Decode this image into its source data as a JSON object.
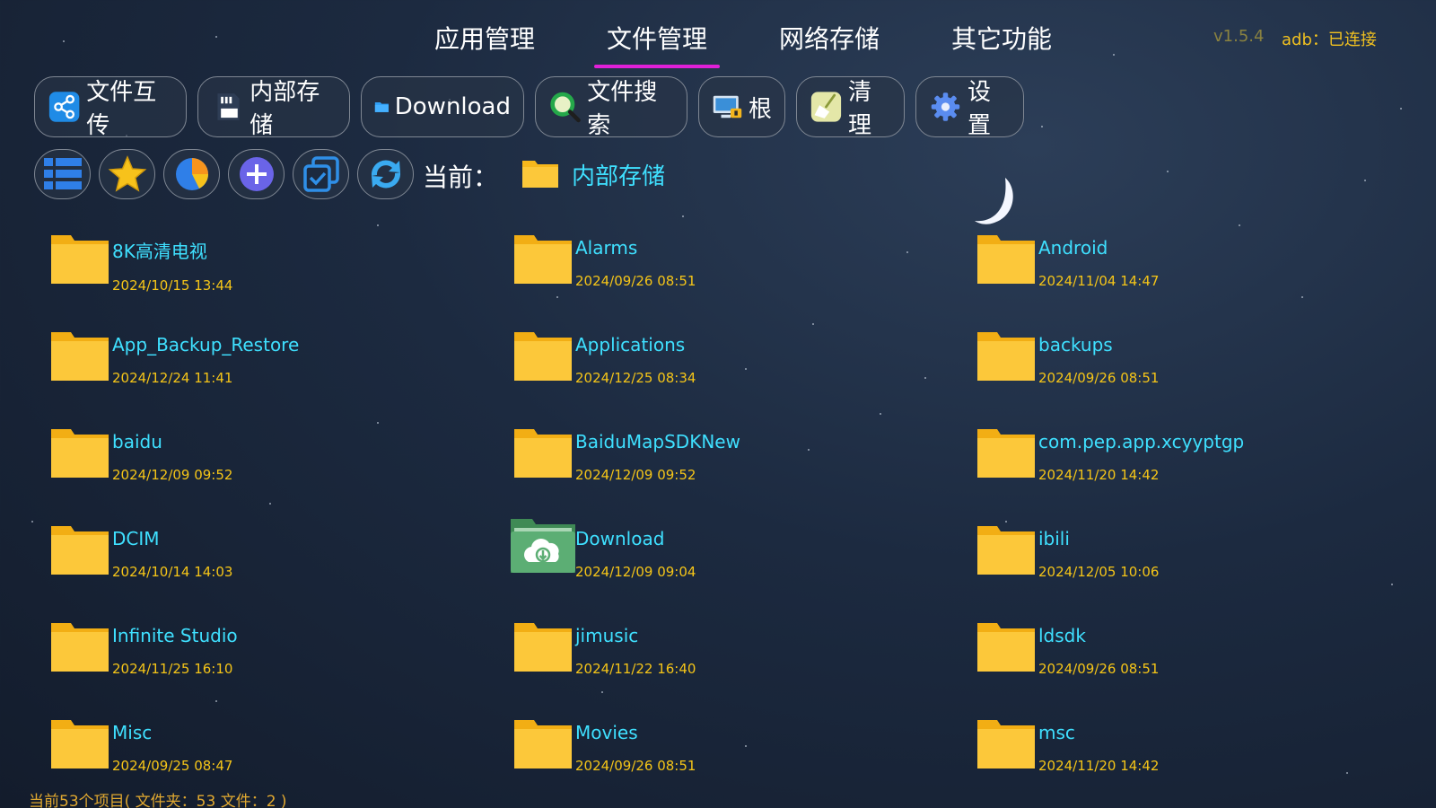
{
  "header": {
    "tabs": [
      {
        "label": "应用管理"
      },
      {
        "label": "文件管理",
        "active": true
      },
      {
        "label": "网络存储"
      },
      {
        "label": "其它功能"
      }
    ],
    "version": "v1.5.4",
    "adb_status": "adb：已连接"
  },
  "toolbar": {
    "buttons": [
      {
        "label": "文件互传",
        "icon": "share-icon"
      },
      {
        "label": "内部存储",
        "icon": "sd-card-icon"
      },
      {
        "label": "Download",
        "icon": "folder-icon"
      },
      {
        "label": "文件搜索",
        "icon": "search-icon"
      },
      {
        "label": "根",
        "icon": "computer-lock-icon"
      },
      {
        "label": "清理",
        "icon": "broom-icon"
      },
      {
        "label": "设置",
        "icon": "gear-icon"
      }
    ]
  },
  "actions": {
    "icons": [
      "list-view-icon",
      "star-icon",
      "pie-chart-icon",
      "add-icon",
      "multi-select-icon",
      "refresh-icon"
    ]
  },
  "current": {
    "label": "当前：",
    "path": "内部存储"
  },
  "files": [
    {
      "name": "8K高清电视",
      "date": "2024/10/15 13:44",
      "icon": "folder-icon"
    },
    {
      "name": "Alarms",
      "date": "2024/09/26 08:51",
      "icon": "folder-icon"
    },
    {
      "name": "Android",
      "date": "2024/11/04 14:47",
      "icon": "folder-icon"
    },
    {
      "name": "App_Backup_Restore",
      "date": "2024/12/24 11:41",
      "icon": "folder-icon"
    },
    {
      "name": "Applications",
      "date": "2024/12/25 08:34",
      "icon": "folder-icon"
    },
    {
      "name": "backups",
      "date": "2024/09/26 08:51",
      "icon": "folder-icon"
    },
    {
      "name": "baidu",
      "date": "2024/12/09 09:52",
      "icon": "folder-icon"
    },
    {
      "name": "BaiduMapSDKNew",
      "date": "2024/12/09 09:52",
      "icon": "folder-icon"
    },
    {
      "name": "com.pep.app.xcyyptgp",
      "date": "2024/11/20 14:42",
      "icon": "folder-icon"
    },
    {
      "name": "DCIM",
      "date": "2024/10/14 14:03",
      "icon": "folder-icon"
    },
    {
      "name": "Download",
      "date": "2024/12/09 09:04",
      "icon": "download-folder-icon"
    },
    {
      "name": "ibili",
      "date": "2024/12/05 10:06",
      "icon": "folder-icon"
    },
    {
      "name": "Infinite Studio",
      "date": "2024/11/25 16:10",
      "icon": "folder-icon"
    },
    {
      "name": "jimusic",
      "date": "2024/11/22 16:40",
      "icon": "folder-icon"
    },
    {
      "name": "ldsdk",
      "date": "2024/09/26 08:51",
      "icon": "folder-icon"
    },
    {
      "name": "Misc",
      "date": "2024/09/25 08:47",
      "icon": "folder-icon"
    },
    {
      "name": "Movies",
      "date": "2024/09/26 08:51",
      "icon": "folder-icon"
    },
    {
      "name": "msc",
      "date": "2024/11/20 14:42",
      "icon": "folder-icon"
    }
  ],
  "status": "当前53个项目( 文件夹：53   文件：2 )",
  "colors": {
    "accent_cyan": "#3fe0ff",
    "date_yellow": "#f5c518",
    "tab_underline": "#e020d8",
    "folder_yellow": "#fcc83a"
  }
}
